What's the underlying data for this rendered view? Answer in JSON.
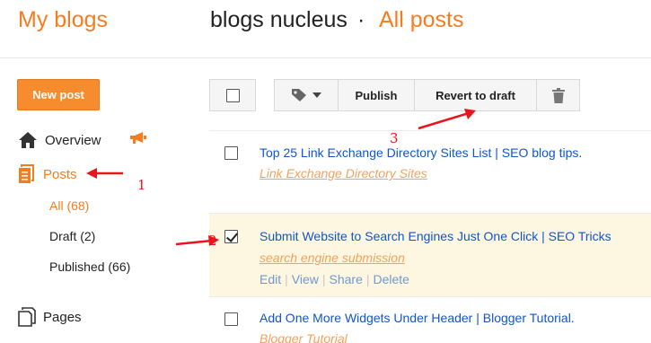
{
  "header": {
    "app_title": "My blogs",
    "blog_name": "blogs nucleus",
    "separator": "·",
    "section": "All posts"
  },
  "sidebar": {
    "new_post": "New post",
    "overview": "Overview",
    "posts": "Posts",
    "sub_items": [
      {
        "label": "All (68)"
      },
      {
        "label": "Draft (2)"
      },
      {
        "label": "Published (66)"
      }
    ],
    "pages": "Pages"
  },
  "toolbar": {
    "publish": "Publish",
    "revert": "Revert to draft"
  },
  "posts": [
    {
      "title": "Top 25 Link Exchange Directory Sites List | SEO blog tips.",
      "label": "Link Exchange Directory Sites",
      "checked": false
    },
    {
      "title": "Submit Website to Search Engines Just One Click | SEO Tricks",
      "label": "search engine submission",
      "checked": true,
      "actions": {
        "edit": "Edit",
        "view": "View",
        "share": "Share",
        "delete": "Delete"
      }
    },
    {
      "title": "Add One More Widgets Under Header | Blogger Tutorial.",
      "label": "Blogger Tutorial",
      "checked": false
    }
  ],
  "annotations": [
    "1",
    "2",
    "3"
  ],
  "colors": {
    "accent": "#f57d20",
    "link": "#1155cc",
    "label": "#f5a15b",
    "selected_row": "#fdf6e1",
    "annotation": "#e8151b"
  }
}
